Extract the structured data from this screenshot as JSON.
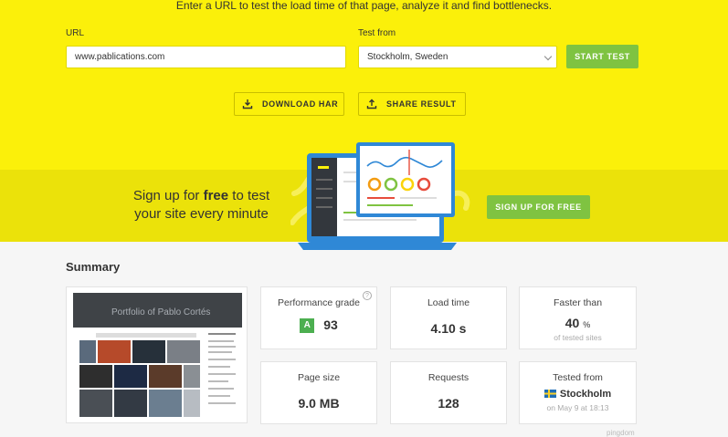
{
  "hero": {
    "tagline": "Enter a URL to test the load time of that page, analyze it and find bottlenecks.",
    "url_label": "URL",
    "url_value": "www.pablications.com",
    "location_label": "Test from",
    "location_value": "Stockholm, Sweden",
    "start_button": "START TEST",
    "download_har": "DOWNLOAD HAR",
    "share_result": "SHARE RESULT"
  },
  "promo": {
    "line1_pre": "Sign up for ",
    "line1_bold": "free",
    "line1_post": " to test",
    "line2": "your site every minute",
    "signup_button": "SIGN UP FOR FREE"
  },
  "summary": {
    "title": "Summary",
    "screenshot_title": "Portfolio of Pablo Cortés",
    "performance": {
      "title": "Performance grade",
      "grade": "A",
      "score": "93"
    },
    "load_time": {
      "title": "Load time",
      "value": "4.10 s"
    },
    "faster_than": {
      "title": "Faster than",
      "value": "40",
      "unit": "%",
      "sub": "of tested sites"
    },
    "page_size": {
      "title": "Page size",
      "value": "9.0 MB"
    },
    "requests": {
      "title": "Requests",
      "value": "128"
    },
    "tested_from": {
      "title": "Tested from",
      "city": "Stockholm",
      "date": "on May 9 at 18:13"
    }
  },
  "footer": {
    "brand": "pingdom"
  },
  "colors": {
    "hero": "#fbf00a",
    "promo": "#ebe20a",
    "accent_green": "#7fc341",
    "grade_green": "#4caf50"
  }
}
